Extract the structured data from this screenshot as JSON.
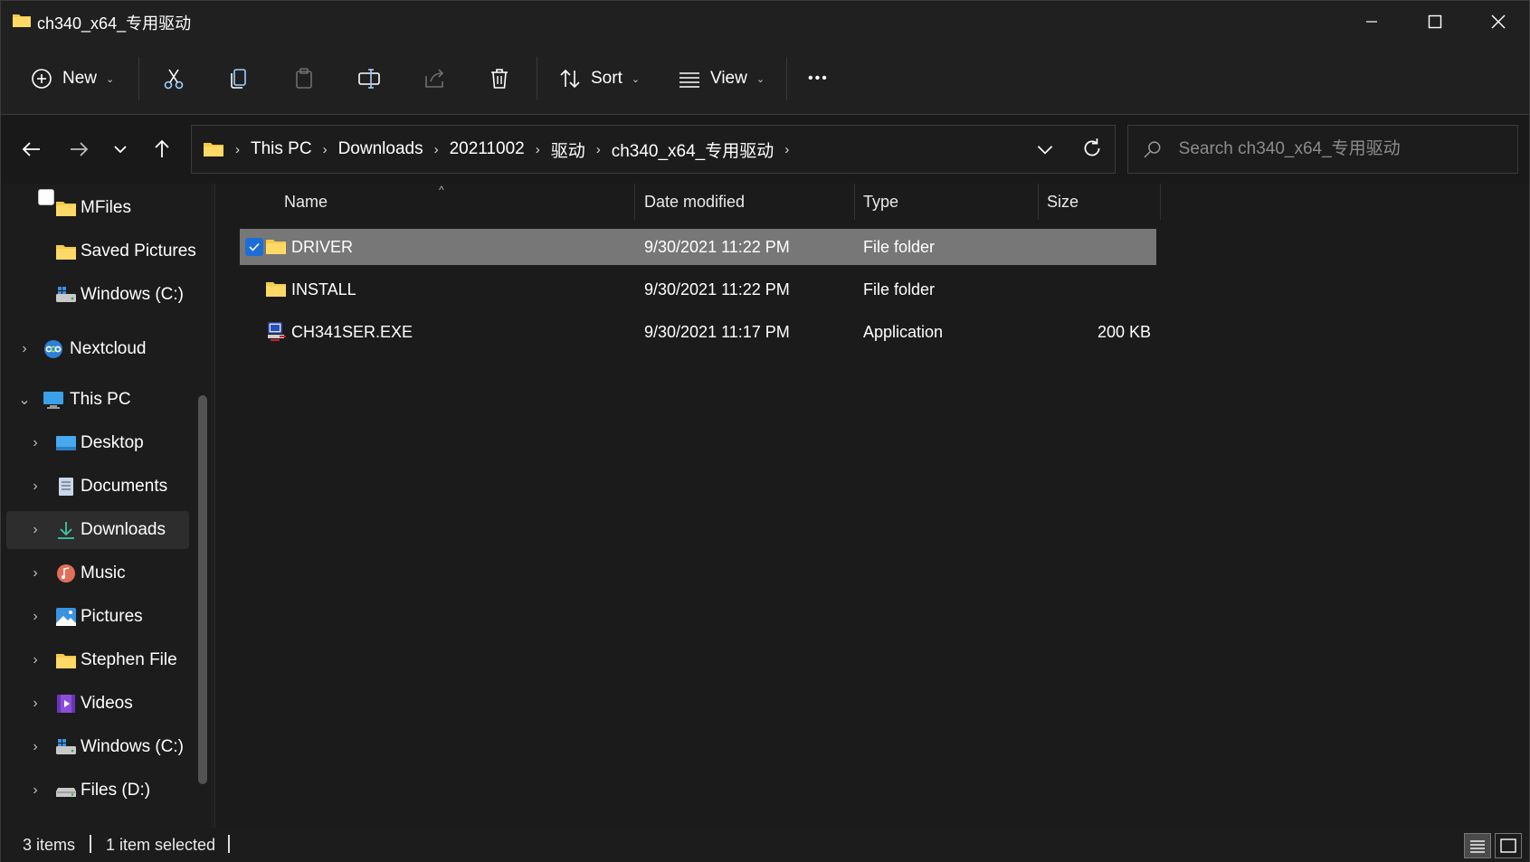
{
  "window": {
    "title": "ch340_x64_专用驱动",
    "minimize_glyph": "—",
    "maximize_glyph": "☐",
    "close_glyph": "✕"
  },
  "toolbar": {
    "new_label": "New",
    "sort_label": "Sort",
    "view_label": "View",
    "more_glyph": "•••",
    "icons": [
      "new-icon",
      "cut-icon",
      "copy-icon",
      "paste-icon",
      "rename-icon",
      "share-icon",
      "delete-icon",
      "sort-icon",
      "view-icon",
      "more-icon"
    ]
  },
  "nav": {
    "back_glyph": "←",
    "forward_glyph": "→",
    "recent_glyph": "⌄",
    "up_glyph": "↑"
  },
  "address": {
    "crumbs": [
      "This PC",
      "Downloads",
      "20211002",
      "驱动",
      "ch340_x64_专用驱动"
    ],
    "separator": "›"
  },
  "search": {
    "placeholder": "Search ch340_x64_专用驱动"
  },
  "sidebar": {
    "items": [
      {
        "label": "MFiles",
        "icon": "folder-icon",
        "expander": ""
      },
      {
        "label": "Saved Pictures",
        "icon": "folder-icon",
        "expander": ""
      },
      {
        "label": "Windows (C:)",
        "icon": "drive-c-icon",
        "expander": ""
      },
      {
        "label": "Nextcloud",
        "icon": "nextcloud-icon",
        "expander": "›"
      },
      {
        "label": "This PC",
        "icon": "this-pc-icon",
        "expander": "⌄"
      },
      {
        "label": "Desktop",
        "icon": "desktop-icon",
        "expander": "›"
      },
      {
        "label": "Documents",
        "icon": "documents-icon",
        "expander": "›"
      },
      {
        "label": "Downloads",
        "icon": "downloads-icon",
        "expander": "›",
        "selected": true
      },
      {
        "label": "Music",
        "icon": "music-icon",
        "expander": "›"
      },
      {
        "label": "Pictures",
        "icon": "pictures-icon",
        "expander": "›"
      },
      {
        "label": "Stephen File",
        "icon": "folder-icon",
        "expander": "›"
      },
      {
        "label": "Videos",
        "icon": "videos-icon",
        "expander": "›"
      },
      {
        "label": "Windows (C:)",
        "icon": "drive-c-icon",
        "expander": "›"
      },
      {
        "label": "Files (D:)",
        "icon": "drive-d-icon",
        "expander": "›"
      }
    ]
  },
  "table": {
    "columns": [
      "Name",
      "Date modified",
      "Type",
      "Size"
    ],
    "sort_glyph": "^",
    "rows": [
      {
        "name": "DRIVER",
        "date": "9/30/2021 11:22 PM",
        "type": "File folder",
        "size": "",
        "icon": "folder-icon",
        "selected": true
      },
      {
        "name": "INSTALL",
        "date": "9/30/2021 11:22 PM",
        "type": "File folder",
        "size": "",
        "icon": "folder-icon",
        "selected": false
      },
      {
        "name": "CH341SER.EXE",
        "date": "9/30/2021 11:17 PM",
        "type": "Application",
        "size": "200 KB",
        "icon": "application-icon",
        "selected": false
      }
    ]
  },
  "status": {
    "items_count": "3 items",
    "selection": "1 item selected"
  },
  "colors": {
    "background": "#1b1b1b",
    "selected_row": "#777777",
    "accent": "#1c6ed6",
    "folder": "#f8c94b"
  }
}
